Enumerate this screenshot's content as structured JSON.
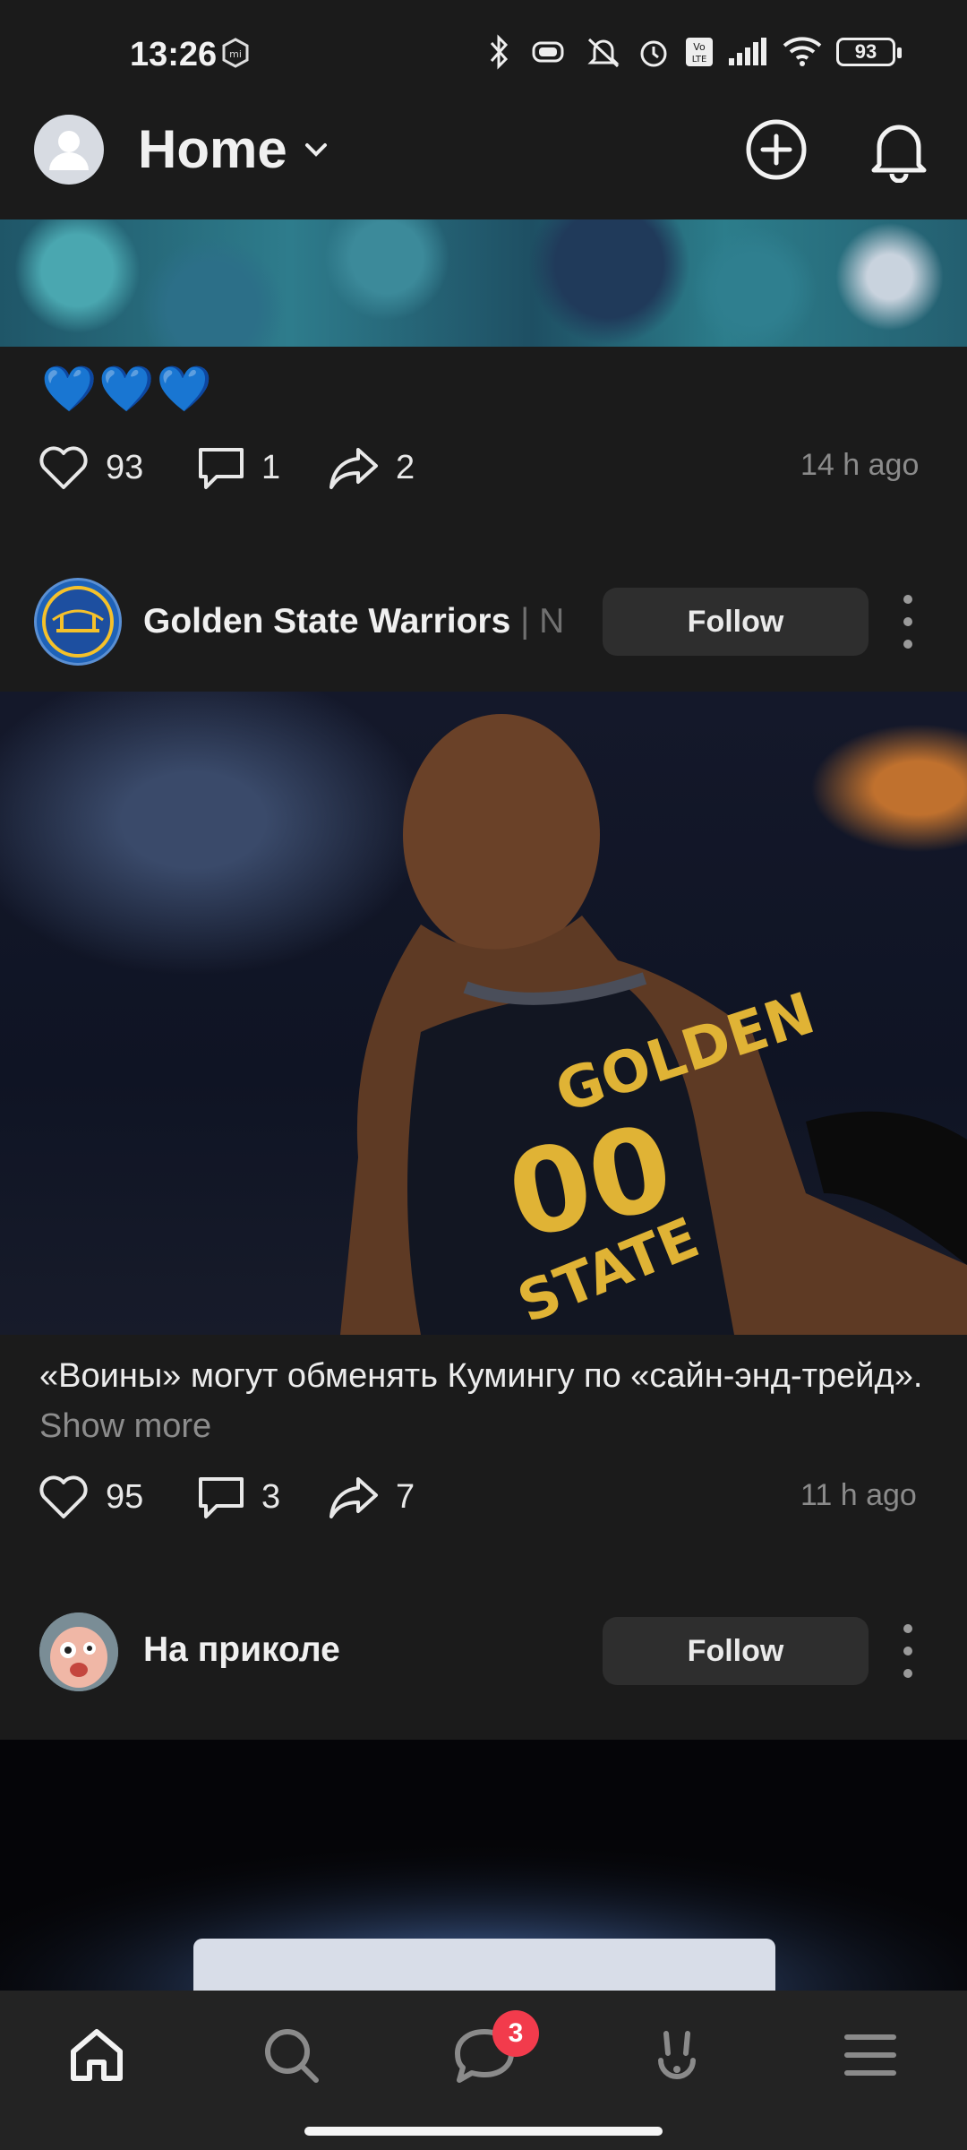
{
  "status_bar": {
    "time": "13:26",
    "battery": "93"
  },
  "header": {
    "title": "Home"
  },
  "feed": {
    "post1": {
      "text": "💙💙💙",
      "likes": "93",
      "comments": "1",
      "shares": "2",
      "time": "14 h ago"
    },
    "post2": {
      "author": "Golden State Warriors",
      "author_suffix": " | NE",
      "follow_label": "Follow",
      "caption": "«Воины» могут обменять Кумингу по «сайн-энд-трейд».",
      "show_more": "Show more",
      "likes": "95",
      "comments": "3",
      "shares": "7",
      "time": "11 h ago"
    },
    "post3": {
      "author": "На приколе",
      "follow_label": "Follow"
    }
  },
  "bottom_nav": {
    "messages_badge": "3"
  }
}
